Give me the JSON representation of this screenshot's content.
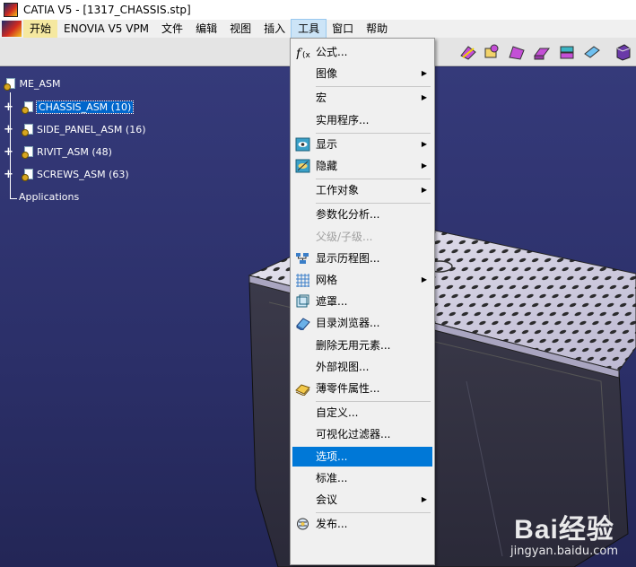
{
  "window": {
    "title": "CATIA V5 - [1317_CHASSIS.stp]"
  },
  "menubar": {
    "items": [
      "开始",
      "ENOVIA V5 VPM",
      "文件",
      "编辑",
      "视图",
      "插入",
      "工具",
      "窗口",
      "帮助"
    ],
    "active": "工具"
  },
  "toolbar": {
    "icons": [
      "sketch-icon",
      "pad-icon",
      "pocket-icon",
      "shaft-icon",
      "groove-icon",
      "hole-icon",
      "part-body-icon"
    ]
  },
  "tree": {
    "root": "ME_ASM",
    "children": [
      {
        "label": "CHASSIS_ASM (10)",
        "selected": true
      },
      {
        "label": "SIDE_PANEL_ASM (16)",
        "selected": false
      },
      {
        "label": "RIVIT_ASM (48)",
        "selected": false
      },
      {
        "label": "SCREWS_ASM (63)",
        "selected": false
      }
    ],
    "applications": "Applications"
  },
  "tools_menu": {
    "groups": [
      [
        {
          "label": "公式...",
          "icon": "formula-icon",
          "submenu": false
        },
        {
          "label": "图像",
          "icon": "",
          "submenu": true
        }
      ],
      [
        {
          "label": "宏",
          "icon": "",
          "submenu": true
        },
        {
          "label": "实用程序...",
          "icon": "",
          "submenu": false
        }
      ],
      [
        {
          "label": "显示",
          "icon": "show-icon",
          "submenu": true
        },
        {
          "label": "隐藏",
          "icon": "hide-icon",
          "submenu": true
        }
      ],
      [
        {
          "label": "工作对象",
          "icon": "",
          "submenu": true
        }
      ],
      [
        {
          "label": "参数化分析...",
          "icon": "",
          "submenu": false
        },
        {
          "label": "父级/子级...",
          "icon": "",
          "submenu": false,
          "disabled": true
        },
        {
          "label": "显示历程图...",
          "icon": "history-graph-icon",
          "submenu": false
        },
        {
          "label": "网格",
          "icon": "grid-icon",
          "submenu": true
        },
        {
          "label": "遮罩...",
          "icon": "mask-icon",
          "submenu": false
        },
        {
          "label": "目录浏览器...",
          "icon": "catalog-browser-icon",
          "submenu": false
        },
        {
          "label": "删除无用元素...",
          "icon": "",
          "submenu": false
        },
        {
          "label": "外部视图...",
          "icon": "",
          "submenu": false
        },
        {
          "label": "薄零件属性...",
          "icon": "thin-part-icon",
          "submenu": false
        }
      ],
      [
        {
          "label": "自定义...",
          "icon": "",
          "submenu": false
        },
        {
          "label": "可视化过滤器...",
          "icon": "",
          "submenu": false
        },
        {
          "label": "选项...",
          "icon": "",
          "submenu": false,
          "highlighted": true
        },
        {
          "label": "标准...",
          "icon": "",
          "submenu": false
        },
        {
          "label": "会议",
          "icon": "",
          "submenu": true
        }
      ],
      [
        {
          "label": "发布...",
          "icon": "publish-icon",
          "submenu": false
        }
      ]
    ]
  },
  "watermark": {
    "brand": "Bai经验",
    "url": "jingyan.baidu.com"
  },
  "colors": {
    "highlight": "#0078d7",
    "viewport": "#2b2f66",
    "selected_node": "#0066cc"
  }
}
